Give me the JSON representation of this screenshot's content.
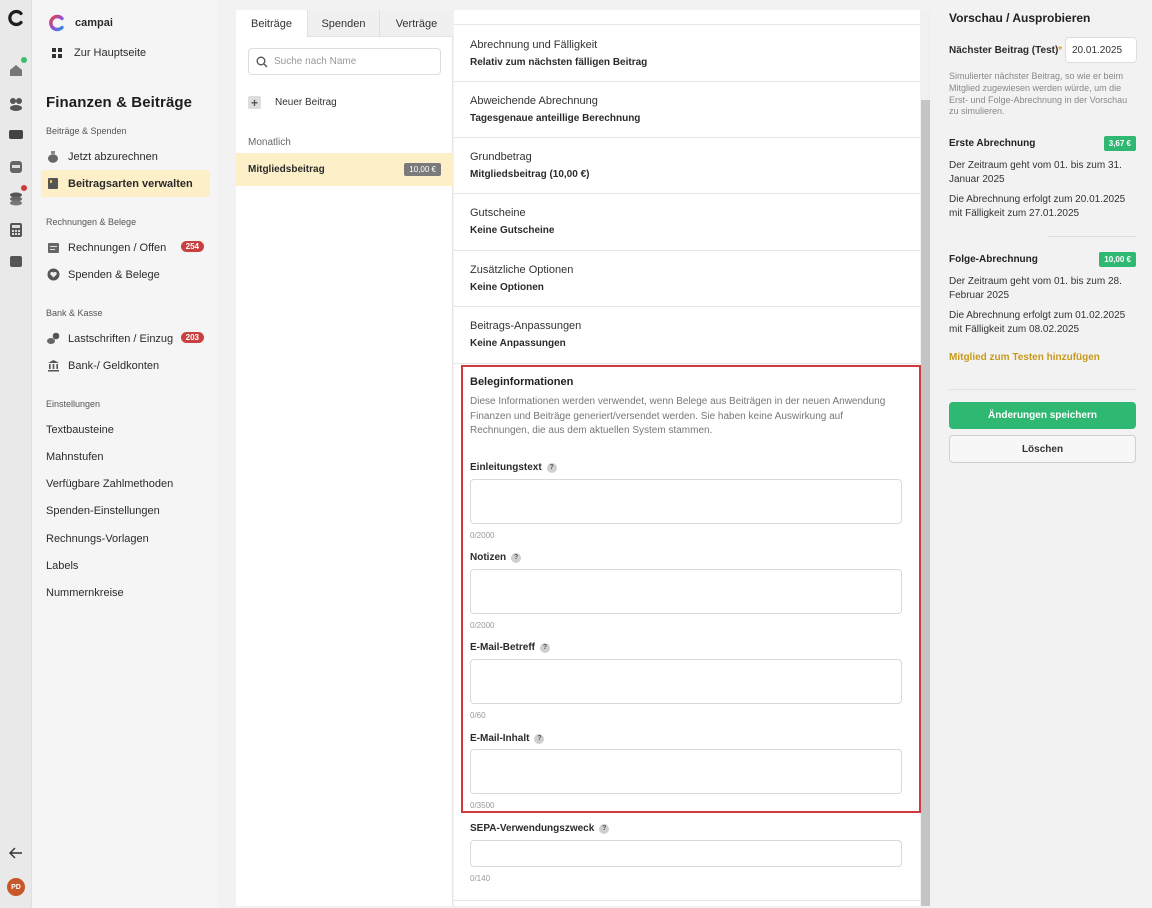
{
  "nav": {
    "org_name": "campai",
    "home_label": "Zur Hauptseite",
    "title": "Finanzen & Beiträge",
    "sections": [
      {
        "header": "Beiträge & Spenden",
        "items": [
          {
            "label": "Jetzt abzurechnen",
            "icon": "money-bag-icon"
          },
          {
            "label": "Beitragsarten verwalten",
            "icon": "ledger-icon",
            "active": true
          }
        ]
      },
      {
        "header": "Rechnungen & Belege",
        "items": [
          {
            "label": "Rechnungen / Offen",
            "icon": "invoice-icon",
            "badge": "254"
          },
          {
            "label": "Spenden & Belege",
            "icon": "heart-icon"
          }
        ]
      },
      {
        "header": "Bank & Kasse",
        "items": [
          {
            "label": "Lastschriften / Einzug",
            "icon": "direct-debit-icon",
            "badge": "203"
          },
          {
            "label": "Bank-/ Geldkonten",
            "icon": "bank-icon"
          }
        ]
      }
    ],
    "settings_header": "Einstellungen",
    "settings_links": [
      "Textbausteine",
      "Mahnstufen",
      "Verfügbare Zahlmethoden",
      "Spenden-Einstellungen",
      "Rechnungs-Vorlagen",
      "Labels",
      "Nummernkreise"
    ]
  },
  "rail": {
    "avatar_initials": "PD",
    "colors": {
      "status_green": "#3cbf6d",
      "status_red": "#d0393e"
    }
  },
  "list": {
    "tabs": [
      "Beiträge",
      "Spenden",
      "Verträge"
    ],
    "search_placeholder": "Suche nach Name",
    "new_label": "Neuer Beitrag",
    "group_label": "Monatlich",
    "items": [
      {
        "name": "Mitgliedsbeitrag",
        "price": "10,00 €"
      }
    ]
  },
  "detail": {
    "rows": [
      {
        "label": "Abrechnung und Fälligkeit",
        "value": "Relativ zum nächsten fälligen Beitrag"
      },
      {
        "label": "Abweichende Abrechnung",
        "value": "Tagesgenaue anteillige Berechnung"
      },
      {
        "label": "Grundbetrag",
        "value": "Mitgliedsbeitrag (10,00 €)"
      },
      {
        "label": "Gutscheine",
        "value": "Keine Gutscheine"
      },
      {
        "label": "Zusätzliche Optionen",
        "value": "Keine Optionen"
      },
      {
        "label": "Beitrags-Anpassungen",
        "value": "Keine Anpassungen"
      }
    ],
    "beleg": {
      "heading": "Beleginformationen",
      "description": "Diese Informationen werden verwendet, wenn Belege aus Beiträgen in der neuen Anwendung Finanzen und Beiträge generiert/versendet werden. Sie haben keine Auswirkung auf Rechnungen, die aus dem aktuellen System stammen.",
      "fields": [
        {
          "label": "Einleitungstext",
          "value": "",
          "counter": "0/2000"
        },
        {
          "label": "Notizen",
          "value": "",
          "counter": "0/2000"
        },
        {
          "label": "E-Mail-Betreff",
          "value": "",
          "counter": "0/60"
        },
        {
          "label": "E-Mail-Inhalt",
          "value": "",
          "counter": "0/3500"
        }
      ]
    },
    "sepa": {
      "label": "SEPA-Verwendungszweck",
      "value": "",
      "counter": "0/140"
    }
  },
  "preview": {
    "title": "Vorschau / Ausprobieren",
    "next_label": "Nächster Beitrag (Test)",
    "required_mark": "*",
    "next_date": "20.01.2025",
    "sim_text": "Simulierter nächster Beitrag, so wie er beim Mitglied zugewiesen werden würde, um die Erst- und Folge-Abrechnung in der Vorschau zu simulieren.",
    "first": {
      "heading": "Erste Abrechnung",
      "amount": "3,67 €",
      "period": "Der Zeitraum geht vom 01. bis zum 31. Januar 2025",
      "due": "Die Abrechnung erfolgt zum 20.01.2025 mit Fälligkeit zum 27.01.2025"
    },
    "follow": {
      "heading": "Folge-Abrechnung",
      "amount": "10,00 €",
      "period": "Der Zeitraum geht vom 01. bis zum 28. Februar 2025",
      "due": "Die Abrechnung erfolgt zum 01.02.2025 mit Fälligkeit zum 08.02.2025"
    },
    "add_member_link": "Mitglied zum Testen hinzufügen",
    "save_label": "Änderungen speichern",
    "delete_label": "Löschen"
  }
}
